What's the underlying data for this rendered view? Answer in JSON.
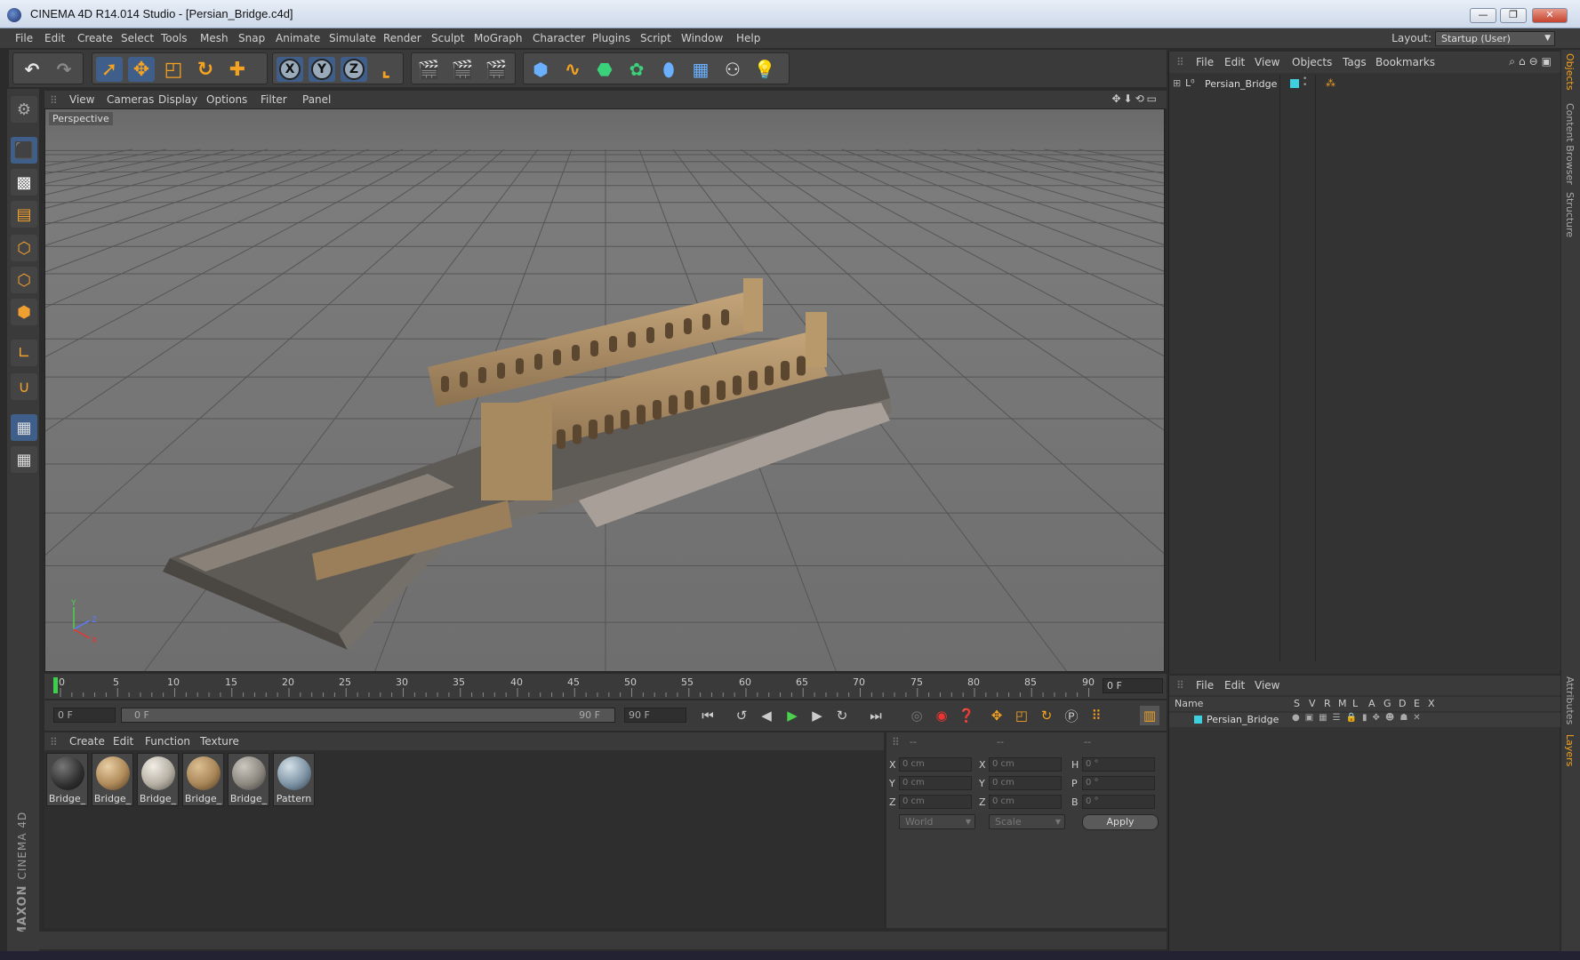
{
  "window": {
    "title": "CINEMA 4D R14.014 Studio - [Persian_Bridge.c4d]",
    "controls": [
      "—",
      "❐",
      "✕"
    ]
  },
  "menu": [
    "File",
    "Edit",
    "Create",
    "Select",
    "Tools",
    "Mesh",
    "Snap",
    "Animate",
    "Simulate",
    "Render",
    "Sculpt",
    "MoGraph",
    "Character",
    "Plugins",
    "Script",
    "Window",
    "Help"
  ],
  "layout": {
    "label": "Layout:",
    "value": "Startup (User)"
  },
  "viewport": {
    "menu": [
      "View",
      "Cameras",
      "Display",
      "Options",
      "Filter",
      "Panel"
    ],
    "label": "Perspective",
    "axes": {
      "y": "Y",
      "z": "Z",
      "x": "X"
    }
  },
  "timeline": {
    "ticks": [
      "0",
      "5",
      "10",
      "15",
      "20",
      "25",
      "30",
      "35",
      "40",
      "45",
      "50",
      "55",
      "60",
      "65",
      "70",
      "75",
      "80",
      "85",
      "90"
    ],
    "current_frame": "0 F",
    "start_field": "0 F",
    "range_start": "0 F",
    "range_end": "90 F",
    "end_field": "90 F"
  },
  "materials": {
    "menu": [
      "Create",
      "Edit",
      "Function",
      "Texture"
    ],
    "items": [
      {
        "label": "Bridge_",
        "color": "#2e2e2e"
      },
      {
        "label": "Bridge_",
        "color": "#b08a5a"
      },
      {
        "label": "Bridge_",
        "color": "#b6b0a4"
      },
      {
        "label": "Bridge_",
        "color": "#a98658"
      },
      {
        "label": "Bridge_",
        "color": "#8d8880"
      },
      {
        "label": "Pattern",
        "color": "#7f95a6"
      }
    ]
  },
  "coordinates": {
    "headers": [
      "--",
      "--",
      "--"
    ],
    "rows": [
      {
        "l1": "X",
        "v1": "0 cm",
        "l2": "X",
        "v2": "0 cm",
        "l3": "H",
        "v3": "0 °"
      },
      {
        "l1": "Y",
        "v1": "0 cm",
        "l2": "Y",
        "v2": "0 cm",
        "l3": "P",
        "v3": "0 °"
      },
      {
        "l1": "Z",
        "v1": "0 cm",
        "l2": "Z",
        "v2": "0 cm",
        "l3": "B",
        "v3": "0 °"
      }
    ],
    "mode": "World",
    "type": "Scale",
    "apply": "Apply"
  },
  "objects": {
    "menu": [
      "File",
      "Edit",
      "View",
      "Objects",
      "Tags",
      "Bookmarks"
    ],
    "items": [
      {
        "name": "Persian_Bridge",
        "color": "#3fd0e0"
      }
    ]
  },
  "layers": {
    "menu": [
      "File",
      "Edit",
      "View"
    ],
    "columns": [
      "Name",
      "S",
      "V",
      "R",
      "M",
      "L",
      "A",
      "G",
      "D",
      "E",
      "X"
    ],
    "items": [
      {
        "name": "Persian_Bridge",
        "color": "#3fd0e0"
      }
    ]
  },
  "right_tabs": [
    "Objects",
    "Content Browser",
    "Structure",
    "Attributes",
    "Layers"
  ],
  "logo": {
    "brand": "MAXON",
    "product": "CINEMA 4D"
  },
  "colors": {
    "accent": "#f3a221",
    "selection": "#3f5f8a",
    "play": "#4bd14b"
  }
}
